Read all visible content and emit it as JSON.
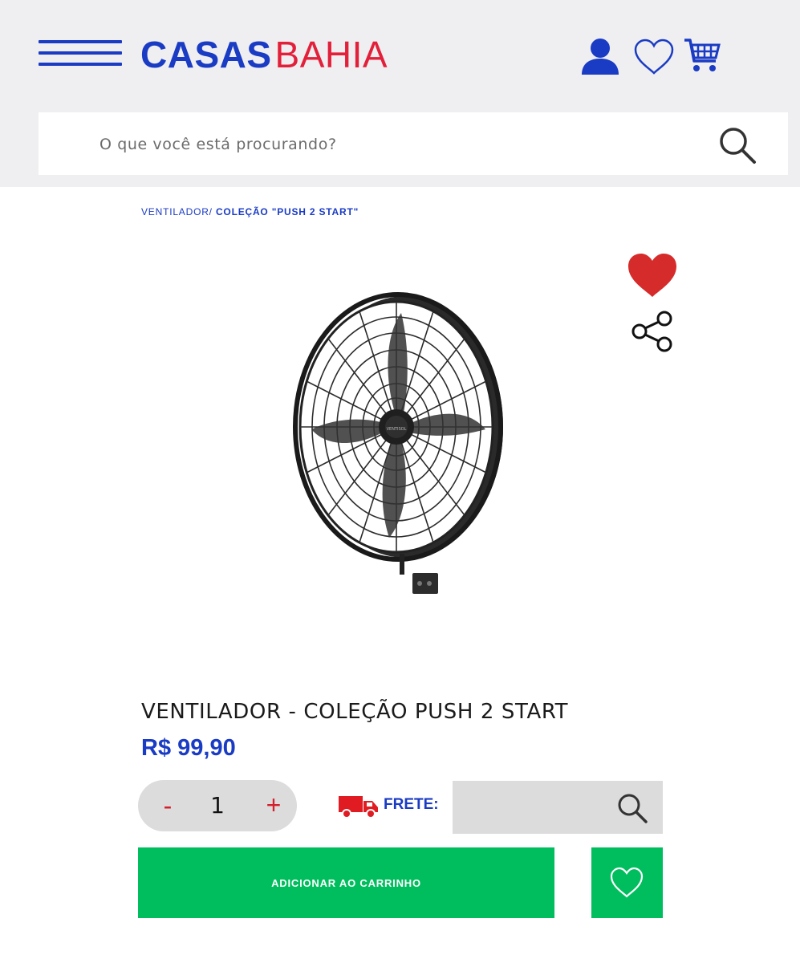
{
  "header": {
    "logo_part1": "CASAS",
    "logo_part2": "BAHIA",
    "icons": [
      "menu-icon",
      "user-icon",
      "heart-icon",
      "cart-icon"
    ]
  },
  "search": {
    "placeholder": "O que você está procurando?",
    "value": ""
  },
  "breadcrumb": {
    "category": "VENTILADOR/",
    "current": "COLEÇÃO \"PUSH 2 START\""
  },
  "product": {
    "title": "VENTILADOR - COLEÇÃO PUSH 2 START",
    "price": "R$ 99,90",
    "brand_mark": "VENTISOL",
    "favorited": true
  },
  "quantity": {
    "minus_label": "-",
    "value": "1",
    "plus_label": "+"
  },
  "shipping": {
    "label": "FRETE:",
    "value": ""
  },
  "actions": {
    "add_to_cart_label": "ADICIONAR AO CARRINHO"
  },
  "colors": {
    "brand_blue": "#1a3bc4",
    "brand_red": "#e2203a",
    "accent_green": "#00be5e",
    "favorite_red": "#d62b2b",
    "header_bg": "#efeff1"
  }
}
